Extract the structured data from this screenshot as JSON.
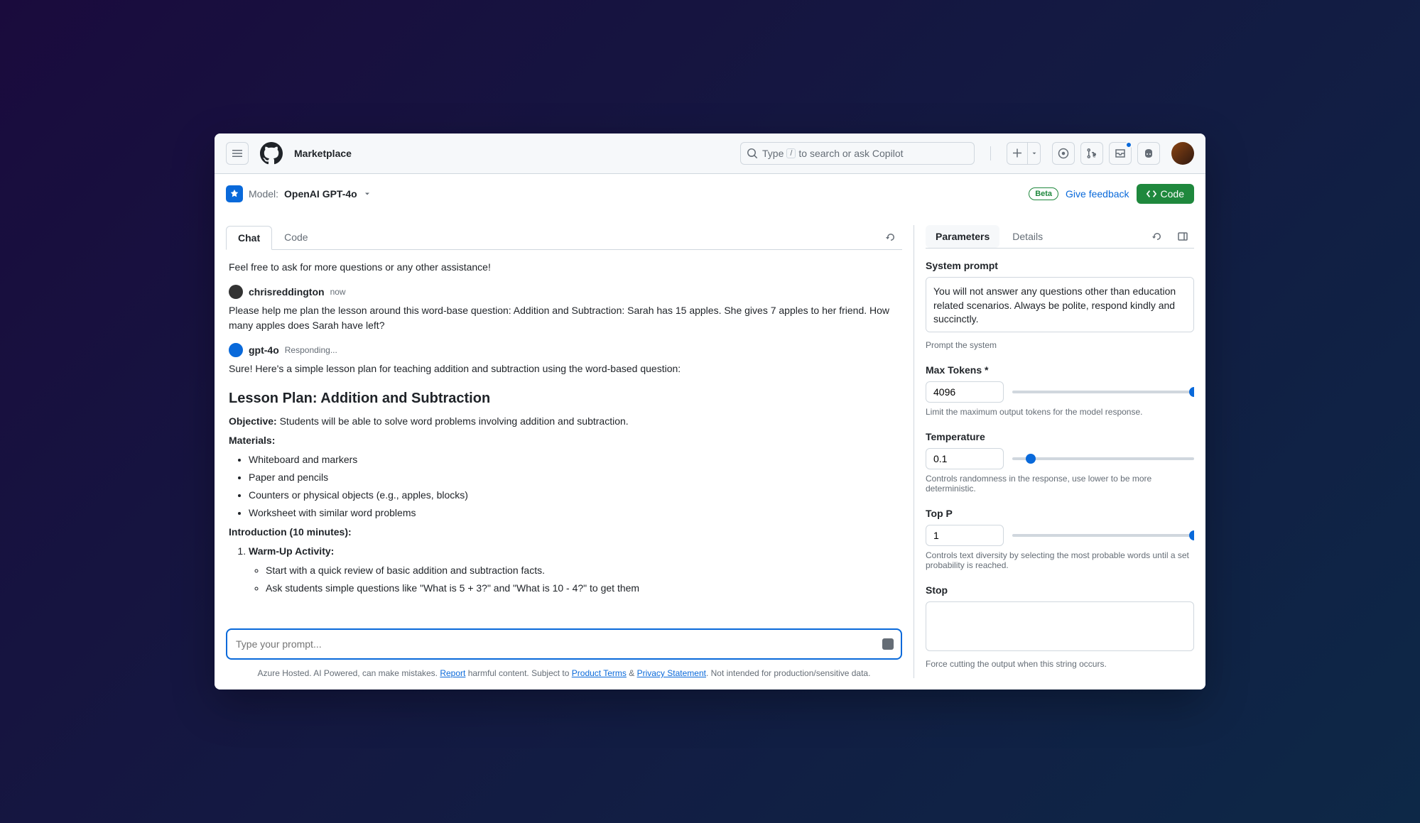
{
  "header": {
    "brand": "Marketplace",
    "search_placeholder_pre": "Type",
    "search_kbd": "/",
    "search_placeholder_post": "to search or ask Copilot"
  },
  "model_bar": {
    "model_prefix": "Model:",
    "model_name": "OpenAI GPT-4o",
    "beta_label": "Beta",
    "feedback_label": "Give feedback",
    "code_btn_label": "Code"
  },
  "left": {
    "tabs": {
      "chat": "Chat",
      "code": "Code"
    },
    "messages": {
      "intro_tail": "Feel free to ask for more questions or any other assistance!",
      "user": {
        "name": "chrisreddington",
        "time": "now",
        "text": "Please help me plan the lesson around this word-base question: Addition and Subtraction: Sarah has 15 apples. She gives 7 apples to her friend. How many apples does Sarah have left?"
      },
      "bot": {
        "name": "gpt-4o",
        "status": "Responding...",
        "intro": "Sure! Here's a simple lesson plan for teaching addition and subtraction using the word-based question:",
        "title": "Lesson Plan: Addition and Subtraction",
        "objective_label": "Objective:",
        "objective_text": " Students will be able to solve word problems involving addition and subtraction.",
        "materials_label": "Materials:",
        "materials": [
          "Whiteboard and markers",
          "Paper and pencils",
          "Counters or physical objects (e.g., apples, blocks)",
          "Worksheet with similar word problems"
        ],
        "intro_label": "Introduction (10 minutes):",
        "warmup_label": "Warm-Up Activity:",
        "warmup_items": [
          "Start with a quick review of basic addition and subtraction facts.",
          "Ask students simple questions like \"What is 5 + 3?\" and \"What is 10 - 4?\" to get them"
        ]
      }
    },
    "prompt_placeholder": "Type your prompt...",
    "disclaimer": {
      "pre": "Azure Hosted. AI Powered, can make mistakes. ",
      "report": "Report",
      "mid1": " harmful content. Subject to ",
      "product_terms": "Product Terms",
      "amp": " & ",
      "privacy": "Privacy Statement",
      "post": ". Not intended for production/sensitive data."
    }
  },
  "right": {
    "tabs": {
      "parameters": "Parameters",
      "details": "Details"
    },
    "system_prompt": {
      "label": "System prompt",
      "value": "You will not answer any questions other than education related scenarios. Always be polite, respond kindly and succinctly.",
      "help": "Prompt the system"
    },
    "max_tokens": {
      "label": "Max Tokens *",
      "value": "4096",
      "help": "Limit the maximum output tokens for the model response."
    },
    "temperature": {
      "label": "Temperature",
      "value": "0.1",
      "help": "Controls randomness in the response, use lower to be more deterministic."
    },
    "top_p": {
      "label": "Top P",
      "value": "1",
      "help": "Controls text diversity by selecting the most probable words until a set probability is reached."
    },
    "stop": {
      "label": "Stop",
      "value": "",
      "help": "Force cutting the output when this string occurs."
    }
  }
}
